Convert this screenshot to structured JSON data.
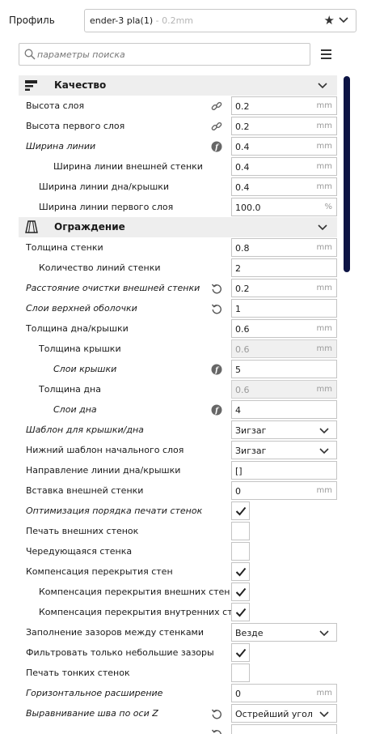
{
  "profile": {
    "label": "Профиль",
    "name": "ender-3 pla(1)",
    "suffix": " - 0.2mm",
    "star_icon": "star-icon",
    "chevron_icon": "chevron-down-icon"
  },
  "search": {
    "placeholder": "параметры поиска",
    "icon": "search-icon",
    "menu_icon": "hamburger-menu-icon"
  },
  "colors": {
    "scrollbar": "#0d1444",
    "category_bg": "#eeeeee",
    "disabled_field_bg": "#f0f0f0"
  },
  "rows": [
    {
      "kind": "category",
      "icon": "quality-icon",
      "label": "Качество",
      "chevron": "chevron-down-icon"
    },
    {
      "kind": "field",
      "label": "Высота слоя",
      "indent": 0,
      "italic": false,
      "icon": "link-icon",
      "value": "0.2",
      "unit": "mm"
    },
    {
      "kind": "field",
      "label": "Высота первого слоя",
      "indent": 0,
      "italic": false,
      "icon": "link-icon",
      "value": "0.2",
      "unit": "mm"
    },
    {
      "kind": "field",
      "label": "Ширина линии",
      "indent": 0,
      "italic": true,
      "icon": "function-icon",
      "value": "0.4",
      "unit": "mm"
    },
    {
      "kind": "field",
      "label": "Ширина линии внешней стенки",
      "indent": 2,
      "italic": false,
      "icon": "",
      "value": "0.4",
      "unit": "mm"
    },
    {
      "kind": "field",
      "label": "Ширина линии дна/крышки",
      "indent": 1,
      "italic": false,
      "icon": "",
      "value": "0.4",
      "unit": "mm"
    },
    {
      "kind": "field",
      "label": "Ширина линии первого слоя",
      "indent": 1,
      "italic": false,
      "icon": "",
      "value": "100.0",
      "unit": "%"
    },
    {
      "kind": "category",
      "icon": "shell-icon",
      "label": "Ограждение",
      "chevron": "chevron-down-icon"
    },
    {
      "kind": "field",
      "label": "Толщина стенки",
      "indent": 0,
      "italic": false,
      "icon": "",
      "value": "0.8",
      "unit": "mm"
    },
    {
      "kind": "field",
      "label": "Количество линий стенки",
      "indent": 1,
      "italic": false,
      "icon": "",
      "value": "2",
      "unit": ""
    },
    {
      "kind": "field",
      "label": "Расстояние очистки внешней стенки",
      "indent": 0,
      "italic": true,
      "icon": "reset-icon",
      "value": "0.2",
      "unit": "mm"
    },
    {
      "kind": "field",
      "label": "Слои верхней оболочки",
      "indent": 0,
      "italic": true,
      "icon": "reset-icon",
      "value": "1",
      "unit": ""
    },
    {
      "kind": "field",
      "label": "Толщина дна/крышки",
      "indent": 0,
      "italic": false,
      "icon": "",
      "value": "0.6",
      "unit": "mm"
    },
    {
      "kind": "field",
      "label": "Толщина крышки",
      "indent": 1,
      "italic": false,
      "icon": "",
      "value": "0.6",
      "unit": "mm",
      "disabled": true
    },
    {
      "kind": "field",
      "label": "Слои крышки",
      "indent": 2,
      "italic": true,
      "icon": "function-icon",
      "value": "5",
      "unit": ""
    },
    {
      "kind": "field",
      "label": "Толщина дна",
      "indent": 1,
      "italic": false,
      "icon": "",
      "value": "0.6",
      "unit": "mm",
      "disabled": true
    },
    {
      "kind": "field",
      "label": "Слои дна",
      "indent": 2,
      "italic": true,
      "icon": "function-icon",
      "value": "4",
      "unit": ""
    },
    {
      "kind": "dropdown",
      "label": "Шаблон для крышки/дна",
      "indent": 0,
      "italic": true,
      "icon": "",
      "value": "Зигзаг"
    },
    {
      "kind": "dropdown",
      "label": "Нижний шаблон начального слоя",
      "indent": 0,
      "italic": false,
      "icon": "",
      "value": "Зигзаг"
    },
    {
      "kind": "field",
      "label": "Направление линии дна/крышки",
      "indent": 0,
      "italic": false,
      "icon": "",
      "value": "[]",
      "unit": ""
    },
    {
      "kind": "field",
      "label": "Вставка внешней стенки",
      "indent": 0,
      "italic": false,
      "icon": "",
      "value": "0",
      "unit": "mm"
    },
    {
      "kind": "check",
      "label": "Оптимизация порядка печати стенок",
      "indent": 0,
      "italic": true,
      "icon": "",
      "checked": true
    },
    {
      "kind": "check",
      "label": "Печать внешних стенок",
      "indent": 0,
      "italic": false,
      "icon": "",
      "checked": false
    },
    {
      "kind": "check",
      "label": "Чередующаяся стенка",
      "indent": 0,
      "italic": false,
      "icon": "",
      "checked": false
    },
    {
      "kind": "check",
      "label": "Компенсация перекрытия стен",
      "indent": 0,
      "italic": false,
      "icon": "",
      "checked": true
    },
    {
      "kind": "check",
      "label": "Компенсация перекрытия внешних стен",
      "indent": 1,
      "italic": false,
      "icon": "",
      "checked": true
    },
    {
      "kind": "check",
      "label": "Компенсация перекрытия внутренних стен",
      "indent": 1,
      "italic": false,
      "icon": "",
      "checked": true
    },
    {
      "kind": "dropdown",
      "label": "Заполнение зазоров между стенками",
      "indent": 0,
      "italic": false,
      "icon": "",
      "value": "Везде"
    },
    {
      "kind": "check",
      "label": "Фильтровать только небольшие зазоры",
      "indent": 0,
      "italic": false,
      "icon": "",
      "checked": true
    },
    {
      "kind": "check",
      "label": "Печать тонких стенок",
      "indent": 0,
      "italic": false,
      "icon": "",
      "checked": false
    },
    {
      "kind": "field",
      "label": "Горизонтальное расширение",
      "indent": 0,
      "italic": true,
      "icon": "",
      "value": "0",
      "unit": "mm"
    },
    {
      "kind": "dropdown",
      "label": "Выравнивание шва по оси Z",
      "indent": 0,
      "italic": true,
      "icon": "reset-icon",
      "value": "Острейший угол"
    },
    {
      "kind": "field",
      "label": "",
      "indent": 0,
      "italic": true,
      "icon": "reset-icon",
      "value": "",
      "unit": ""
    }
  ]
}
